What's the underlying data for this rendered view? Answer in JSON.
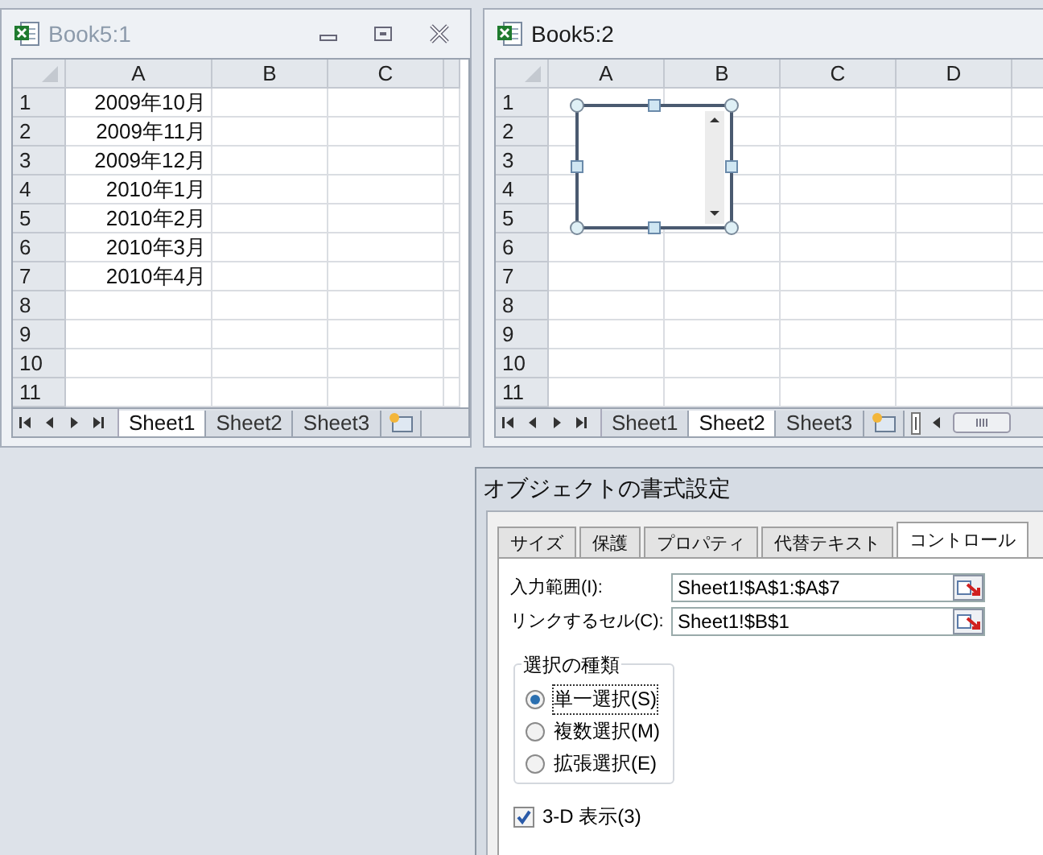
{
  "windows": [
    {
      "title": "Book5:1",
      "active": false,
      "caption_buttons": true,
      "columns": [
        "A",
        "B",
        "C"
      ],
      "rows": [
        {
          "number": "1",
          "cells": [
            "2009年10月"
          ]
        },
        {
          "number": "2",
          "cells": [
            "2009年11月"
          ]
        },
        {
          "number": "3",
          "cells": [
            "2009年12月"
          ]
        },
        {
          "number": "4",
          "cells": [
            "2010年1月"
          ]
        },
        {
          "number": "5",
          "cells": [
            "2010年2月"
          ]
        },
        {
          "number": "6",
          "cells": [
            "2010年3月"
          ]
        },
        {
          "number": "7",
          "cells": [
            "2010年4月"
          ]
        },
        {
          "number": "8"
        },
        {
          "number": "9"
        },
        {
          "number": "10"
        },
        {
          "number": "11"
        }
      ],
      "sheet_tabs": [
        {
          "label": "Sheet1",
          "selected": true
        },
        {
          "label": "Sheet2",
          "selected": false
        },
        {
          "label": "Sheet3",
          "selected": false
        }
      ]
    },
    {
      "title": "Book5:2",
      "active": true,
      "caption_buttons": false,
      "columns": [
        "A",
        "B",
        "C",
        "D"
      ],
      "rows": [
        {
          "number": "1"
        },
        {
          "number": "2"
        },
        {
          "number": "3"
        },
        {
          "number": "4"
        },
        {
          "number": "5"
        },
        {
          "number": "6"
        },
        {
          "number": "7"
        },
        {
          "number": "8"
        },
        {
          "number": "9"
        },
        {
          "number": "10"
        },
        {
          "number": "11"
        }
      ],
      "list_box": {
        "selected": true
      },
      "sheet_tabs": [
        {
          "label": "Sheet1",
          "selected": false
        },
        {
          "label": "Sheet2",
          "selected": true
        },
        {
          "label": "Sheet3",
          "selected": false
        }
      ]
    }
  ],
  "dialog": {
    "title": "オブジェクトの書式設定",
    "tabs": [
      {
        "label": "サイズ",
        "selected": false
      },
      {
        "label": "保護",
        "selected": false
      },
      {
        "label": "プロパティ",
        "selected": false
      },
      {
        "label": "代替テキスト",
        "selected": false
      },
      {
        "label": "コントロール",
        "selected": true
      }
    ],
    "fields": [
      {
        "label": "入力範囲(I):",
        "value": "Sheet1!$A$1:$A$7"
      },
      {
        "label": "リンクするセル(C):",
        "value": "Sheet1!$B$1"
      }
    ],
    "selection_type": {
      "legend": "選択の種類",
      "options": [
        {
          "label": "単一選択(S)",
          "selected": true
        },
        {
          "label": "複数選択(M)",
          "selected": false
        },
        {
          "label": "拡張選択(E)",
          "selected": false
        }
      ]
    },
    "checkbox": {
      "label": "3-D 表示(3)",
      "checked": true
    }
  }
}
